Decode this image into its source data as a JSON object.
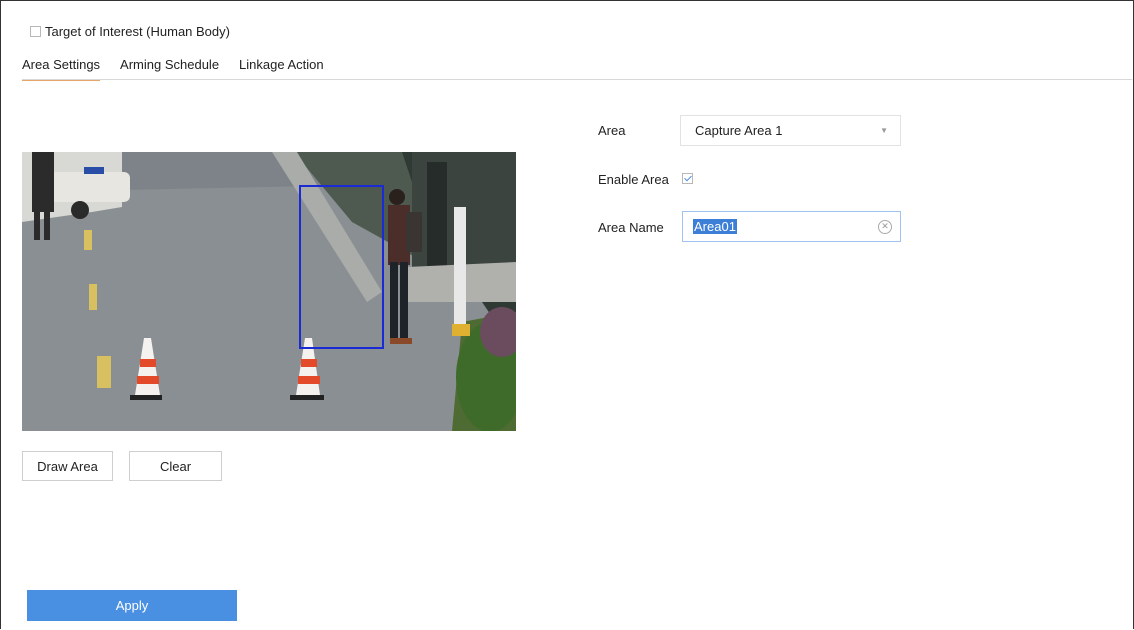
{
  "target": {
    "label": "Target of Interest (Human Body)",
    "checked": false
  },
  "tabs": [
    {
      "label": "Area Settings",
      "active": true
    },
    {
      "label": "Arming Schedule",
      "active": false
    },
    {
      "label": "Linkage Action",
      "active": false
    }
  ],
  "buttons": {
    "draw_area": "Draw Area",
    "clear": "Clear",
    "apply": "Apply"
  },
  "form": {
    "area_label": "Area",
    "area_value": "Capture Area 1",
    "enable_label": "Enable Area",
    "enable_checked": true,
    "name_label": "Area Name",
    "name_value": "Area01"
  },
  "icons": {
    "clear_input": "close-circle-icon",
    "dropdown": "chevron-down-icon"
  },
  "colors": {
    "accent": "#4a90e2",
    "tab_underline": "#e8a56a",
    "detection_box": "#1a2bd6"
  }
}
